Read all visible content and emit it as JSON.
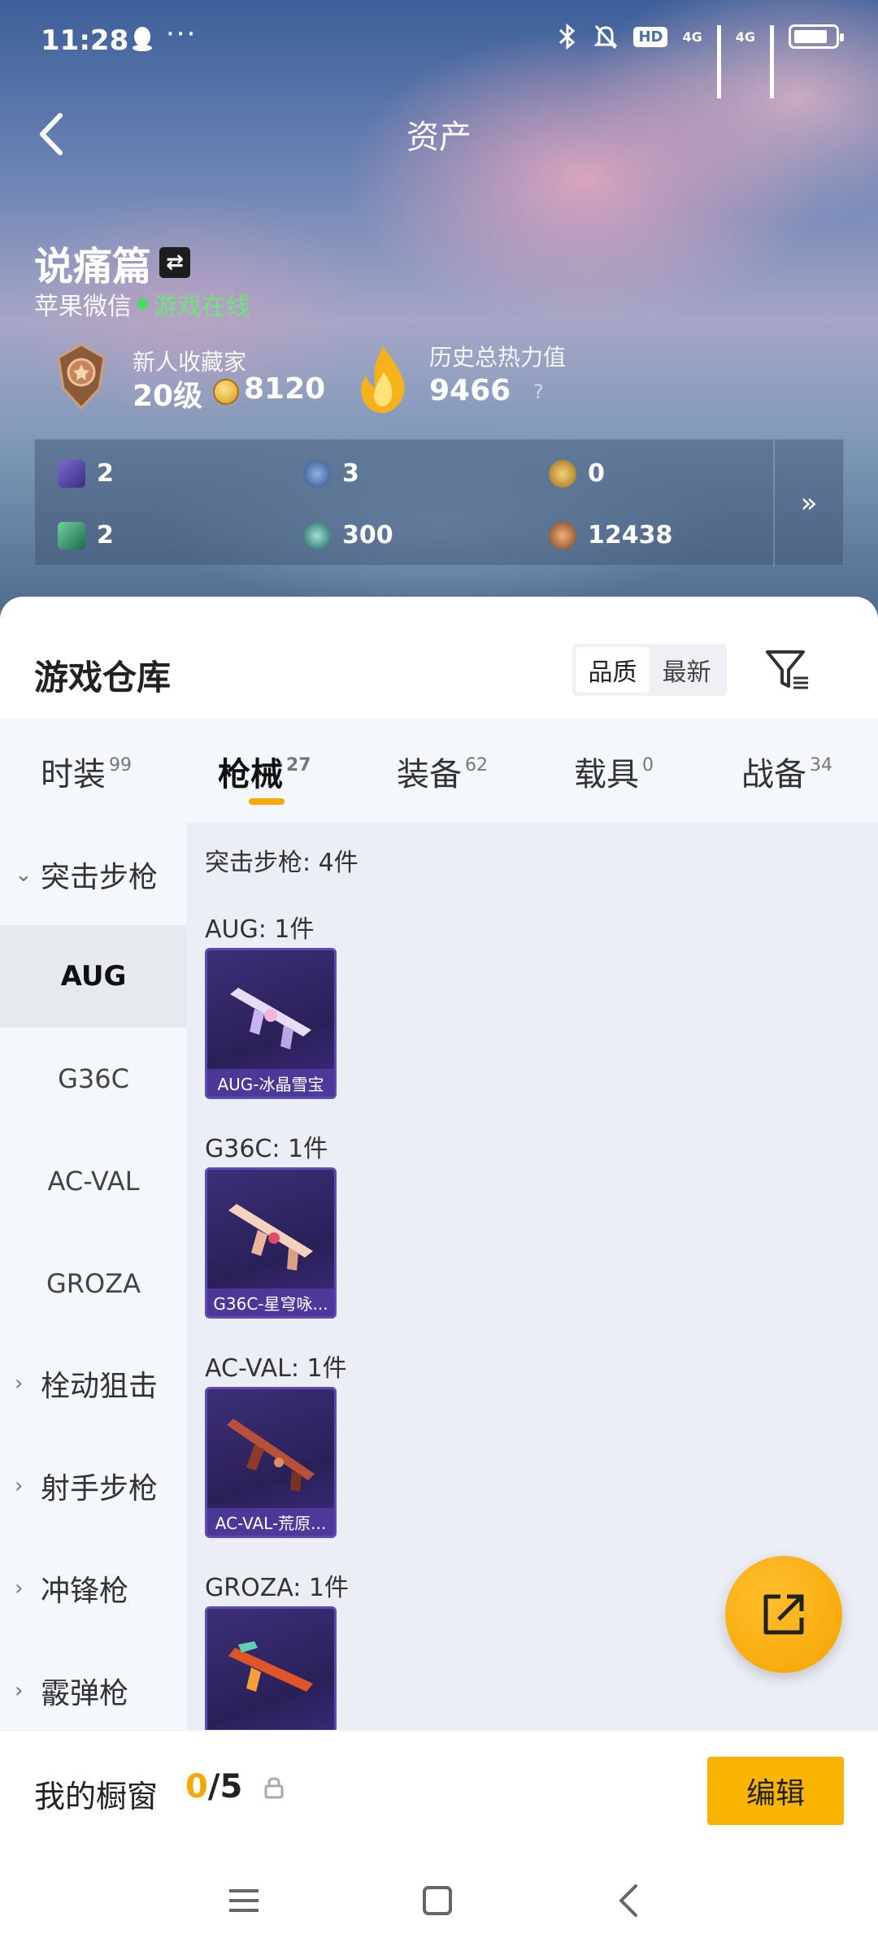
{
  "status_bar": {
    "time": "11:28",
    "dots": "···",
    "hd": "HD",
    "net1": "4G",
    "net2": "4G"
  },
  "header": {
    "title": "资产"
  },
  "player": {
    "name": "说痛篇",
    "platform": "苹果微信",
    "status": "游戏在线",
    "rank_title": "新人收藏家",
    "level": "20级",
    "points": "8120",
    "heat_label": "历史总热力值",
    "heat_value": "9466",
    "help": "?"
  },
  "resources": [
    {
      "value": "2",
      "icon": "purple-card-icon",
      "color": "#5a4aa8"
    },
    {
      "value": "3",
      "icon": "blue-token-icon",
      "color": "#3f6fb0"
    },
    {
      "value": "0",
      "icon": "gold-token-icon",
      "color": "#d4a21c"
    },
    {
      "value": "2",
      "icon": "green-card-icon",
      "color": "#3e9b6a"
    },
    {
      "value": "300",
      "icon": "teal-coin-icon",
      "color": "#2c8a86"
    },
    {
      "value": "12438",
      "icon": "bronze-coin-icon",
      "color": "#b5703a"
    }
  ],
  "resources_more": "»",
  "warehouse": {
    "title": "游戏仓库",
    "sort_options": [
      "品质",
      "最新"
    ],
    "sort_active": "品质"
  },
  "tabs": [
    {
      "label": "时装",
      "count": "99"
    },
    {
      "label": "枪械",
      "count": "27",
      "active": true
    },
    {
      "label": "装备",
      "count": "62"
    },
    {
      "label": "载具",
      "count": "0"
    },
    {
      "label": "战备",
      "count": "34"
    }
  ],
  "sidebar": {
    "expanded_category": "突击步枪",
    "sub_items": [
      "AUG",
      "G36C",
      "AC-VAL",
      "GROZA"
    ],
    "active_sub": "AUG",
    "categories": [
      "栓动狙击",
      "射手步枪",
      "冲锋枪",
      "霰弹枪"
    ]
  },
  "content": {
    "summary": "突击步枪: 4件",
    "groups": [
      {
        "label": "AUG: 1件",
        "item": "AUG-冰晶雪宝",
        "gun_color": "#d9c8f0"
      },
      {
        "label": "G36C: 1件",
        "item": "G36C-星穹咏...",
        "gun_color": "#f0c9b8"
      },
      {
        "label": "AC-VAL: 1件",
        "item": "AC-VAL-荒原...",
        "gun_color": "#c0533a"
      },
      {
        "label": "GROZA: 1件",
        "item": "",
        "gun_color": "#e0542a"
      }
    ]
  },
  "showcase": {
    "title": "我的橱窗",
    "current": "0",
    "total": "/5",
    "edit": "编辑"
  },
  "colors": {
    "accent": "#f5a800",
    "online": "#4cd964"
  }
}
